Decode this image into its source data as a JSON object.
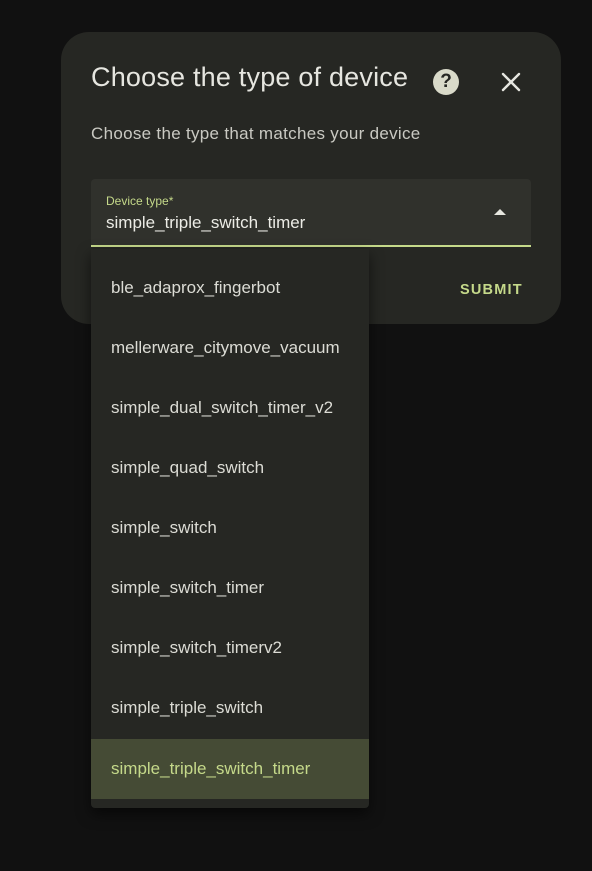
{
  "dialog": {
    "title": "Choose the type of device",
    "subtitle": "Choose the type that matches your device",
    "help_icon": "help-circle-icon",
    "close_icon": "close-icon",
    "submit_label": "SUBMIT"
  },
  "select": {
    "label": "Device type*",
    "value": "simple_triple_switch_timer",
    "arrow_icon": "caret-up-icon"
  },
  "dropdown": {
    "options": [
      "ble_adaprox_fingerbot",
      "mellerware_citymove_vacuum",
      "simple_dual_switch_timer_v2",
      "simple_quad_switch",
      "simple_switch",
      "simple_switch_timer",
      "simple_switch_timerv2",
      "simple_triple_switch",
      "simple_triple_switch_timer"
    ],
    "selected_index": 8
  },
  "colors": {
    "background": "#111111",
    "surface": "#262723",
    "accent": "#c5d98a",
    "selected_bg": "#454b35"
  }
}
